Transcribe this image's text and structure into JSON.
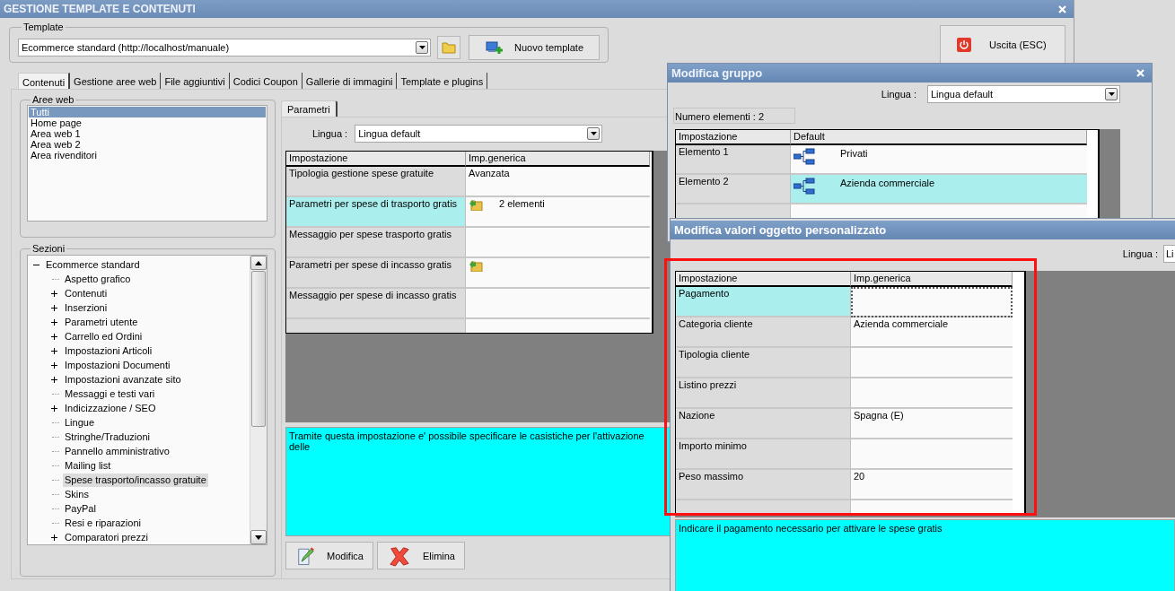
{
  "window": {
    "title": "GESTIONE TEMPLATE E CONTENUTI"
  },
  "template": {
    "label": "Template",
    "value": "Ecommerce standard (http://localhost/manuale)",
    "new_button": "Nuovo template"
  },
  "exit_button": "Uscita (ESC)",
  "tabs": [
    {
      "label": "Contenuti",
      "selected": true
    },
    {
      "label": "Gestione aree web",
      "selected": false
    },
    {
      "label": "File aggiuntivi",
      "selected": false
    },
    {
      "label": "Codici Coupon",
      "selected": false
    },
    {
      "label": "Gallerie di immagini",
      "selected": false
    },
    {
      "label": "Template e plugins",
      "selected": false
    }
  ],
  "web_areas": {
    "label": "Aree web",
    "items": [
      {
        "label": "Tutti",
        "selected": true
      },
      {
        "label": "Home page",
        "selected": false
      },
      {
        "label": "Area web 1",
        "selected": false
      },
      {
        "label": "Area web 2",
        "selected": false
      },
      {
        "label": "Area rivenditori",
        "selected": false
      }
    ]
  },
  "sections": {
    "label": "Sezioni",
    "tree": [
      {
        "label": "Ecommerce standard",
        "expanded": true,
        "selected": false,
        "children": [
          {
            "label": "Aspetto grafico",
            "expandable": false,
            "selected": false
          },
          {
            "label": "Contenuti",
            "expandable": true,
            "selected": false
          },
          {
            "label": "Inserzioni",
            "expandable": true,
            "selected": false
          },
          {
            "label": "Parametri utente",
            "expandable": true,
            "selected": false
          },
          {
            "label": "Carrello ed Ordini",
            "expandable": true,
            "selected": false
          },
          {
            "label": "Impostazioni Articoli",
            "expandable": true,
            "selected": false
          },
          {
            "label": "Impostazioni Documenti",
            "expandable": true,
            "selected": false
          },
          {
            "label": "Impostazioni avanzate sito",
            "expandable": true,
            "selected": false
          },
          {
            "label": "Messaggi e testi vari",
            "expandable": false,
            "selected": false
          },
          {
            "label": "Indicizzazione / SEO",
            "expandable": true,
            "selected": false
          },
          {
            "label": "Lingue",
            "expandable": false,
            "selected": false
          },
          {
            "label": "Stringhe/Traduzioni",
            "expandable": false,
            "selected": false
          },
          {
            "label": "Pannello amministrativo",
            "expandable": false,
            "selected": false
          },
          {
            "label": "Mailing list",
            "expandable": false,
            "selected": false
          },
          {
            "label": "Spese trasporto/incasso gratuite",
            "expandable": false,
            "selected": true
          },
          {
            "label": "Skins",
            "expandable": false,
            "selected": false
          },
          {
            "label": "PayPal",
            "expandable": false,
            "selected": false
          },
          {
            "label": "Resi e riparazioni",
            "expandable": false,
            "selected": false
          },
          {
            "label": "Comparatori prezzi",
            "expandable": true,
            "selected": false
          }
        ]
      }
    ]
  },
  "subtabs": [
    {
      "label": "Parametri",
      "selected": true
    }
  ],
  "language": {
    "label": "Lingua :",
    "value": "Lingua default"
  },
  "params_table": {
    "columns": [
      "Impostazione",
      "Imp.generica"
    ],
    "rows": [
      {
        "setting": "Tipologia gestione spese gratuite",
        "value": "Avanzata",
        "has_icon": false,
        "selected": false
      },
      {
        "setting": "Parametri per spese di trasporto gratis",
        "value": "2 elementi",
        "has_icon": true,
        "selected": true
      },
      {
        "setting": "Messaggio per spese trasporto gratis",
        "has_icon": false,
        "selected": false
      },
      {
        "setting": "Parametri per spese di incasso gratis",
        "has_icon": true,
        "selected": false
      },
      {
        "setting": "Messaggio per spese di incasso gratis",
        "has_icon": false,
        "selected": false
      }
    ]
  },
  "description": "Tramite questa impostazione e' possibile specificare le casistiche per l'attivazione delle",
  "buttons": [
    {
      "label": "Modifica",
      "kind": "edit"
    },
    {
      "label": "Elimina",
      "kind": "delete"
    }
  ],
  "group_dialog": {
    "title": "Modifica gruppo",
    "language": {
      "label": "Lingua :",
      "value": "Lingua default"
    },
    "count": "Numero elementi : 2",
    "columns": [
      "Impostazione",
      "Default"
    ],
    "rows": [
      {
        "setting": "Elemento 1",
        "value": "Privati",
        "selected": false
      },
      {
        "setting": "Elemento 2",
        "value": "Azienda commerciale",
        "selected": true
      }
    ]
  },
  "object_dialog": {
    "title": "Modifica valori oggetto personalizzato",
    "language": {
      "label": "Lingua :",
      "value": "Li"
    },
    "columns": [
      "Impostazione",
      "Imp.generica"
    ],
    "rows": [
      {
        "setting": "Pagamento",
        "selected": true
      },
      {
        "setting": "Categoria cliente",
        "value": "Azienda commerciale",
        "selected": false
      },
      {
        "setting": "Tipologia cliente",
        "selected": false
      },
      {
        "setting": "Listino prezzi",
        "selected": false
      },
      {
        "setting": "Nazione",
        "value": "Spagna (E)",
        "selected": false
      },
      {
        "setting": "Importo minimo",
        "selected": false
      },
      {
        "setting": "Peso massimo",
        "value": "20",
        "selected": false
      }
    ],
    "description": "Indicare il pagamento necessario per attivare le spese gratis"
  }
}
